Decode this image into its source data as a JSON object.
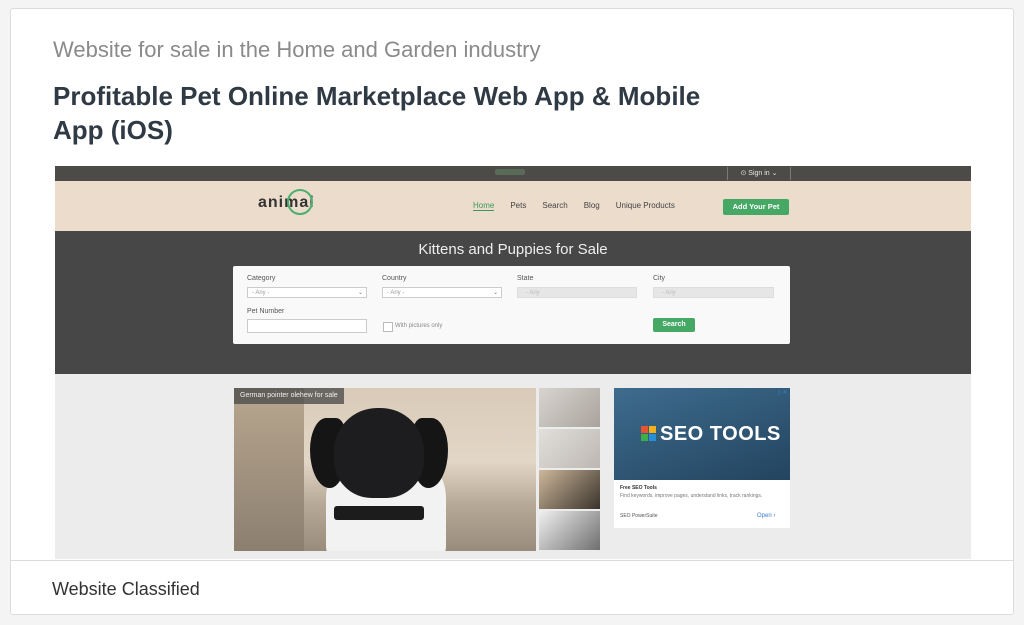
{
  "listing": {
    "category_line": "Website for sale in the Home and Garden industry",
    "title": "Profitable Pet Online Marketplace Web App & Mobile App (iOS)",
    "footer_label": "Website Classified"
  },
  "preview": {
    "topbar": {
      "signin_label": "⊙ Sign in ⌄"
    },
    "nav": {
      "logo_text": "animal",
      "items": [
        "Home",
        "Pets",
        "Search",
        "Blog",
        "Unique Products"
      ],
      "cta_label": "Add Your Pet"
    },
    "hero": {
      "heading": "Kittens and Puppies for Sale",
      "form": {
        "category_label": "Category",
        "category_value": "- Any -",
        "country_label": "Country",
        "country_value": "- Any -",
        "state_label": "State",
        "state_value": "- Any",
        "city_label": "City",
        "city_value": "- Any",
        "pet_number_label": "Pet Number",
        "pictures_only_label": "With pictures only",
        "search_label": "Search"
      }
    },
    "photo_caption": "German pointer olehew for sale",
    "ad": {
      "headline": "SEO TOOLS",
      "title": "Free SEO Tools",
      "desc": "Find keywords, improve pages, understand links, track rankings.",
      "brand": "SEO PowerSuite",
      "open_label": "Open ›",
      "ad_marker": "▷✕"
    },
    "colors": {
      "accent_green": "#45a865",
      "nav_bg": "#ecdccb",
      "hero_bg": "#474747"
    }
  }
}
